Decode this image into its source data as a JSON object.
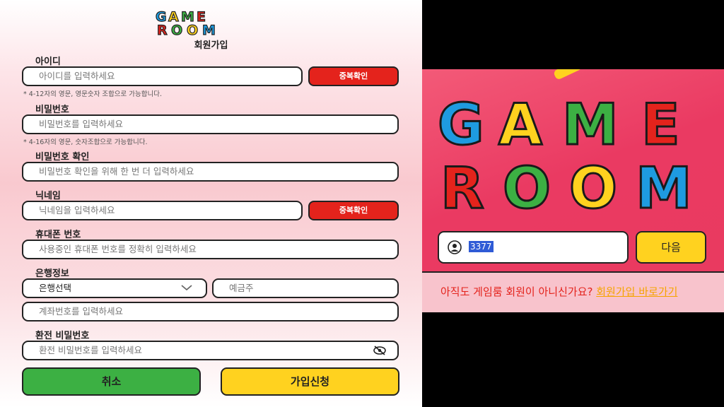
{
  "signup": {
    "logo_text_top": "GAME",
    "logo_text_bottom": "ROOM",
    "title": "회원가입",
    "username": {
      "label": "아이디",
      "placeholder": "아이디를 입력하세요",
      "check_button": "중복확인",
      "note": "* 4-12자의 영문, 영문숫자 조합으로 가능합니다."
    },
    "password": {
      "label": "비밀번호",
      "placeholder": "비밀번호를 입력하세요",
      "note": "* 4-16자의 영문, 숫자조합으로 가능합니다."
    },
    "password_confirm": {
      "label": "비밀번호 확인",
      "placeholder": "비밀번호 확인을 위해 한 번 더 입력하세요"
    },
    "nickname": {
      "label": "닉네임",
      "placeholder": "닉네임을 입력하세요",
      "check_button": "중복확인"
    },
    "phone": {
      "label": "휴대폰 번호",
      "placeholder": "사용중인 휴대폰 번호를 정확히 입력하세요"
    },
    "bank": {
      "label": "은행정보",
      "select_value": "은행선택",
      "holder_placeholder": "예금주",
      "account_placeholder": "계좌번호를 입력하세요"
    },
    "withdraw_password": {
      "label": "환전 비밀번호",
      "placeholder": "환전 비밀번호를 입력하세요"
    },
    "cancel_button": "취소",
    "submit_button": "가입신청"
  },
  "login": {
    "logo_text_top": "GAME",
    "logo_text_bottom": "ROOM",
    "code_value": "3377",
    "next_button": "다음",
    "prompt_text": "아직도 게임룸 회원이 아니신가요? ",
    "prompt_link": "회원가입 바로가기"
  },
  "colors": {
    "red": "#e4231c",
    "green": "#3cb043",
    "yellow": "#ffd21f",
    "blue": "#1e9be0",
    "pink_bg": "#ea3a62"
  }
}
